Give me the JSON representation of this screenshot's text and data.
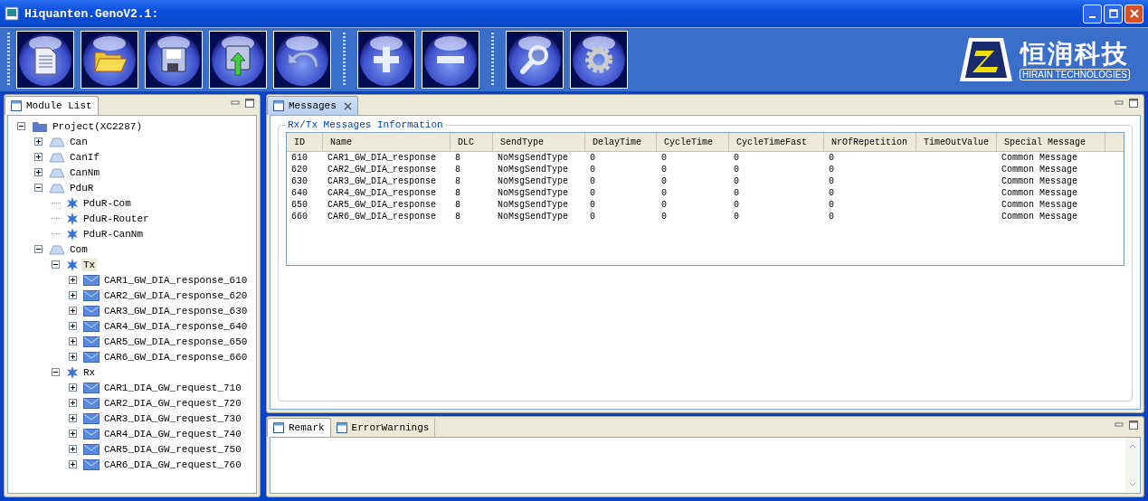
{
  "window": {
    "title": "Hiquanten.GenoV2.1:"
  },
  "toolbar": [
    {
      "kind": "new"
    },
    {
      "kind": "open"
    },
    {
      "kind": "save"
    },
    {
      "kind": "export"
    },
    {
      "kind": "undo"
    },
    {
      "kind": "separator"
    },
    {
      "kind": "add"
    },
    {
      "kind": "remove"
    },
    {
      "kind": "separator"
    },
    {
      "kind": "search"
    },
    {
      "kind": "settings"
    }
  ],
  "logo": {
    "name": "恒润科技",
    "subtitle": "HIRAIN TECHNOLOGIES"
  },
  "module_list": {
    "tab": "Module List",
    "tree": [
      {
        "label": "Project(XC2287)",
        "kind": "folder",
        "expanded": true,
        "selected": false,
        "children": [
          {
            "label": "Can",
            "kind": "module",
            "expanded": false,
            "selected": false
          },
          {
            "label": "CanIf",
            "kind": "module",
            "expanded": false,
            "selected": false
          },
          {
            "label": "CanNm",
            "kind": "module",
            "expanded": false,
            "selected": false
          },
          {
            "label": "PduR",
            "kind": "module",
            "expanded": true,
            "selected": false,
            "children": [
              {
                "label": "PduR-Com",
                "kind": "component",
                "selected": false
              },
              {
                "label": "PduR-Router",
                "kind": "component",
                "selected": false
              },
              {
                "label": "PduR-CanNm",
                "kind": "component",
                "selected": false
              }
            ]
          },
          {
            "label": "Com",
            "kind": "module",
            "expanded": true,
            "selected": false,
            "children": [
              {
                "label": "Tx",
                "kind": "component",
                "expanded": true,
                "selected": true,
                "children": [
                  {
                    "label": "CAR1_GW_DIA_response_610",
                    "kind": "message",
                    "expanded": false,
                    "selected": false
                  },
                  {
                    "label": "CAR2_GW_DIA_response_620",
                    "kind": "message",
                    "expanded": false,
                    "selected": false
                  },
                  {
                    "label": "CAR3_GW_DIA_response_630",
                    "kind": "message",
                    "expanded": false,
                    "selected": false
                  },
                  {
                    "label": "CAR4_GW_DIA_response_640",
                    "kind": "message",
                    "expanded": false,
                    "selected": false
                  },
                  {
                    "label": "CAR5_GW_DIA_response_650",
                    "kind": "message",
                    "expanded": false,
                    "selected": false
                  },
                  {
                    "label": "CAR6_GW_DIA_response_660",
                    "kind": "message",
                    "expanded": false,
                    "selected": false
                  }
                ]
              },
              {
                "label": "Rx",
                "kind": "component",
                "expanded": true,
                "selected": false,
                "children": [
                  {
                    "label": "CAR1_DIA_GW_request_710",
                    "kind": "message",
                    "expanded": false,
                    "selected": false
                  },
                  {
                    "label": "CAR2_DIA_GW_request_720",
                    "kind": "message",
                    "expanded": false,
                    "selected": false
                  },
                  {
                    "label": "CAR3_DIA_GW_request_730",
                    "kind": "message",
                    "expanded": false,
                    "selected": false
                  },
                  {
                    "label": "CAR4_DIA_GW_request_740",
                    "kind": "message",
                    "expanded": false,
                    "selected": false
                  },
                  {
                    "label": "CAR5_DIA_GW_request_750",
                    "kind": "message",
                    "expanded": false,
                    "selected": false
                  },
                  {
                    "label": "CAR6_DIA_GW_request_760",
                    "kind": "message",
                    "expanded": false,
                    "selected": false
                  }
                ]
              }
            ]
          }
        ]
      }
    ]
  },
  "messages": {
    "tab": "Messages",
    "group_title": "Rx/Tx Messages Information",
    "table": {
      "columns": [
        "ID",
        "Name",
        "DLC",
        "SendType",
        "DelayTime",
        "CycleTime",
        "CycleTimeFast",
        "NrOfRepetition",
        "TimeOutValue",
        "Special Message"
      ],
      "rows": [
        [
          "610",
          "CAR1_GW_DIA_response",
          "8",
          "NoMsgSendType",
          "0",
          "0",
          "0",
          "0",
          "",
          "Common Message"
        ],
        [
          "620",
          "CAR2_GW_DIA_response",
          "8",
          "NoMsgSendType",
          "0",
          "0",
          "0",
          "0",
          "",
          "Common Message"
        ],
        [
          "630",
          "CAR3_GW_DIA_response",
          "8",
          "NoMsgSendType",
          "0",
          "0",
          "0",
          "0",
          "",
          "Common Message"
        ],
        [
          "640",
          "CAR4_GW_DIA_response",
          "8",
          "NoMsgSendType",
          "0",
          "0",
          "0",
          "0",
          "",
          "Common Message"
        ],
        [
          "650",
          "CAR5_GW_DIA_response",
          "8",
          "NoMsgSendType",
          "0",
          "0",
          "0",
          "0",
          "",
          "Common Message"
        ],
        [
          "660",
          "CAR6_GW_DIA_response",
          "8",
          "NoMsgSendType",
          "0",
          "0",
          "0",
          "0",
          "",
          "Common Message"
        ]
      ]
    }
  },
  "bottom_tabs": [
    {
      "label": "Remark",
      "selected": true
    },
    {
      "label": "ErrorWarnings",
      "selected": false
    }
  ]
}
